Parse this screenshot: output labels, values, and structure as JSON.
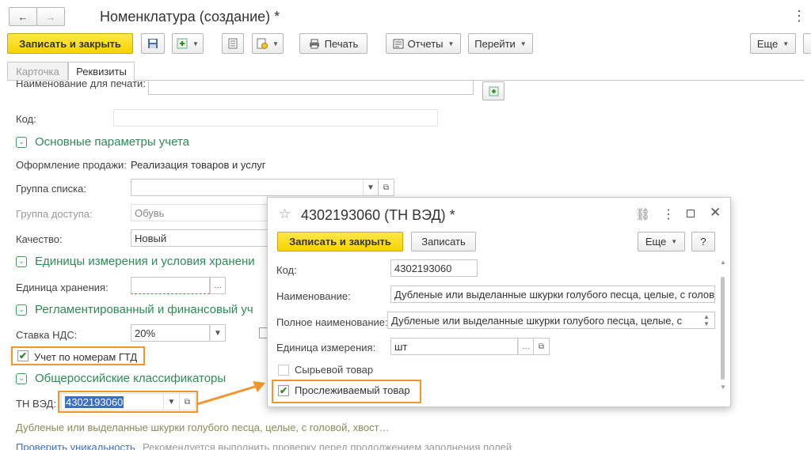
{
  "window": {
    "title": "Номенклатура (создание) *",
    "back_icon": "←",
    "forward_icon": "→",
    "menu_icon": "⋮"
  },
  "toolbar": {
    "save_close": "Записать и закрыть",
    "print": "Печать",
    "reports": "Отчеты",
    "goto": "Перейти",
    "more": "Еще"
  },
  "tabs": [
    {
      "label": "Карточка",
      "active": false
    },
    {
      "label": "Реквизиты",
      "active": true
    }
  ],
  "form": {
    "print_name_label": "Наименование для печати:",
    "code_label": "Код:",
    "section_main": "Основные параметры учета",
    "sale_label": "Оформление продажи:",
    "sale_value": "Реализация товаров и услуг",
    "list_group_label": "Группа списка:",
    "access_group_label": "Группа доступа:",
    "access_group_value": "Обувь",
    "quality_label": "Качество:",
    "quality_value": "Новый",
    "section_units": "Единицы измерения и условия хранени",
    "storage_unit_label": "Единица хранения:",
    "section_reg": "Регламентированный и финансовый уч",
    "vat_label": "Ставка НДС:",
    "vat_value": "20%",
    "gtd_label": "Учет по номерам ГТД",
    "section_class": "Общероссийские классификаторы",
    "tnved_label": "ТН ВЭД:",
    "tnved_value": "4302193060",
    "description": "Дубленые или выделанные шкурки голубого песца, целые, с головой, хвост…",
    "check_link": "Проверить уникальность",
    "check_hint": "Рекомендуется выполнить проверку перед продолжением заполнения полей"
  },
  "dialog": {
    "title": "4302193060 (ТН ВЭД) *",
    "save_close": "Записать и закрыть",
    "save": "Записать",
    "more": "Еще",
    "help": "?",
    "code_label": "Код:",
    "code_value": "4302193060",
    "name_label": "Наименование:",
    "name_value": "Дубленые или выделанные шкурки голубого песца, целые, с голов",
    "full_name_label": "Полное наименование:",
    "full_name_value": "Дубленые или выделанные шкурки голубого песца, целые, с",
    "unit_label": "Единица измерения:",
    "unit_value": "шт",
    "raw_label": "Сырьевой товар",
    "traceable_label": "Прослеживаемый товар"
  },
  "colors": {
    "accent_yellow": "#f5d300",
    "section_green": "#2e8b57",
    "highlight_orange": "#f0962d",
    "selection_blue": "#3b6fc4"
  }
}
